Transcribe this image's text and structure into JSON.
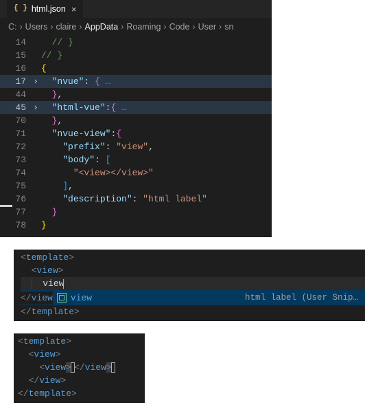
{
  "panel1": {
    "tab": {
      "icon": "{ }",
      "name": "html.json"
    },
    "breadcrumbs": [
      "C:",
      "Users",
      "claire",
      "AppData",
      "Roaming",
      "Code",
      "User",
      "sn"
    ],
    "breadcrumbs_active_index": 3,
    "lines": [
      {
        "n": 14,
        "fold": "",
        "seg": [
          {
            "c": "tk-cm",
            "t": "  // }"
          }
        ]
      },
      {
        "n": 15,
        "fold": "",
        "seg": [
          {
            "c": "tk-cm",
            "t": "// }"
          }
        ]
      },
      {
        "n": 16,
        "fold": "",
        "seg": [
          {
            "c": "tk-br",
            "t": "{"
          }
        ]
      },
      {
        "n": 17,
        "fold": ">",
        "folded": true,
        "seg": [
          {
            "c": "tk-pn",
            "t": "  "
          },
          {
            "c": "tk-key",
            "t": "\"nvue\""
          },
          {
            "c": "tk-pn",
            "t": ": "
          },
          {
            "c": "tk-br2",
            "t": "{"
          },
          {
            "c": "tk-el",
            "t": " …"
          }
        ]
      },
      {
        "n": 44,
        "fold": "",
        "seg": [
          {
            "c": "tk-pn",
            "t": "  "
          },
          {
            "c": "tk-br2",
            "t": "}"
          },
          {
            "c": "tk-pn",
            "t": ","
          }
        ]
      },
      {
        "n": 45,
        "fold": ">",
        "folded": true,
        "seg": [
          {
            "c": "tk-pn",
            "t": "  "
          },
          {
            "c": "tk-key",
            "t": "\"html-vue\""
          },
          {
            "c": "tk-pn",
            "t": ":"
          },
          {
            "c": "tk-br2",
            "t": "{"
          },
          {
            "c": "tk-el",
            "t": " …"
          }
        ]
      },
      {
        "n": 70,
        "fold": "",
        "seg": [
          {
            "c": "tk-pn",
            "t": "  "
          },
          {
            "c": "tk-br2",
            "t": "}"
          },
          {
            "c": "tk-pn",
            "t": ","
          }
        ]
      },
      {
        "n": 71,
        "fold": "",
        "seg": [
          {
            "c": "tk-pn",
            "t": "  "
          },
          {
            "c": "tk-key",
            "t": "\"nvue-view\""
          },
          {
            "c": "tk-pn",
            "t": ":"
          },
          {
            "c": "tk-br2",
            "t": "{"
          }
        ]
      },
      {
        "n": 72,
        "fold": "",
        "seg": [
          {
            "c": "tk-pn",
            "t": "    "
          },
          {
            "c": "tk-key",
            "t": "\"prefix\""
          },
          {
            "c": "tk-pn",
            "t": ": "
          },
          {
            "c": "tk-str",
            "t": "\"view\""
          },
          {
            "c": "tk-pn",
            "t": ","
          }
        ]
      },
      {
        "n": 73,
        "fold": "",
        "seg": [
          {
            "c": "tk-pn",
            "t": "    "
          },
          {
            "c": "tk-key",
            "t": "\"body\""
          },
          {
            "c": "tk-pn",
            "t": ": "
          },
          {
            "c": "tk-bl",
            "t": "["
          }
        ]
      },
      {
        "n": 74,
        "fold": "",
        "seg": [
          {
            "c": "tk-pn",
            "t": "      "
          },
          {
            "c": "tk-str",
            "t": "\"<view></view>\""
          }
        ]
      },
      {
        "n": 75,
        "fold": "",
        "seg": [
          {
            "c": "tk-pn",
            "t": "    "
          },
          {
            "c": "tk-bl",
            "t": "]"
          },
          {
            "c": "tk-pn",
            "t": ","
          }
        ]
      },
      {
        "n": 76,
        "fold": "",
        "seg": [
          {
            "c": "tk-pn",
            "t": "    "
          },
          {
            "c": "tk-key",
            "t": "\"description\""
          },
          {
            "c": "tk-pn",
            "t": ": "
          },
          {
            "c": "tk-str",
            "t": "\"html label\""
          }
        ]
      },
      {
        "n": 77,
        "fold": "",
        "seg": [
          {
            "c": "tk-pn",
            "t": "  "
          },
          {
            "c": "tk-br2",
            "t": "}"
          }
        ]
      },
      {
        "n": 78,
        "fold": "",
        "seg": [
          {
            "c": "tk-br",
            "t": "}"
          }
        ]
      }
    ]
  },
  "panel2": {
    "lines": [
      [
        {
          "c": "ab",
          "t": "<"
        },
        {
          "c": "tg",
          "t": "template"
        },
        {
          "c": "ab",
          "t": ">"
        }
      ],
      [
        {
          "c": "",
          "t": "  "
        },
        {
          "c": "ab",
          "t": "<"
        },
        {
          "c": "tg",
          "t": "view"
        },
        {
          "c": "ab",
          "t": ">"
        }
      ]
    ],
    "typed": "view",
    "close_view": [
      {
        "c": "",
        "t": "  "
      },
      {
        "c": "ab",
        "t": "</"
      },
      {
        "c": "tg",
        "t": "view"
      }
    ],
    "close_template": [
      {
        "c": "ab",
        "t": "</"
      },
      {
        "c": "tg",
        "t": "template"
      },
      {
        "c": "ab",
        "t": ">"
      }
    ],
    "suggestion": {
      "label": "view",
      "hint": "html label (User Snip…"
    }
  },
  "panel3": {
    "lines": [
      [
        {
          "c": "ab",
          "t": "<"
        },
        {
          "c": "tg",
          "t": "template"
        },
        {
          "c": "ab",
          "t": ">"
        }
      ],
      [
        {
          "c": "",
          "t": "  "
        },
        {
          "c": "ab",
          "t": "<"
        },
        {
          "c": "tg",
          "t": "view"
        },
        {
          "c": "ab",
          "t": ">"
        }
      ],
      "__insert__",
      [
        {
          "c": "",
          "t": "  "
        },
        {
          "c": "ab",
          "t": "</"
        },
        {
          "c": "tg",
          "t": "view"
        },
        {
          "c": "ab",
          "t": ">"
        }
      ],
      [
        {
          "c": "ab",
          "t": "</"
        },
        {
          "c": "tg",
          "t": "template"
        },
        {
          "c": "ab",
          "t": ">"
        }
      ]
    ],
    "insert": {
      "open_tag": "view",
      "close_tag": "view"
    }
  }
}
